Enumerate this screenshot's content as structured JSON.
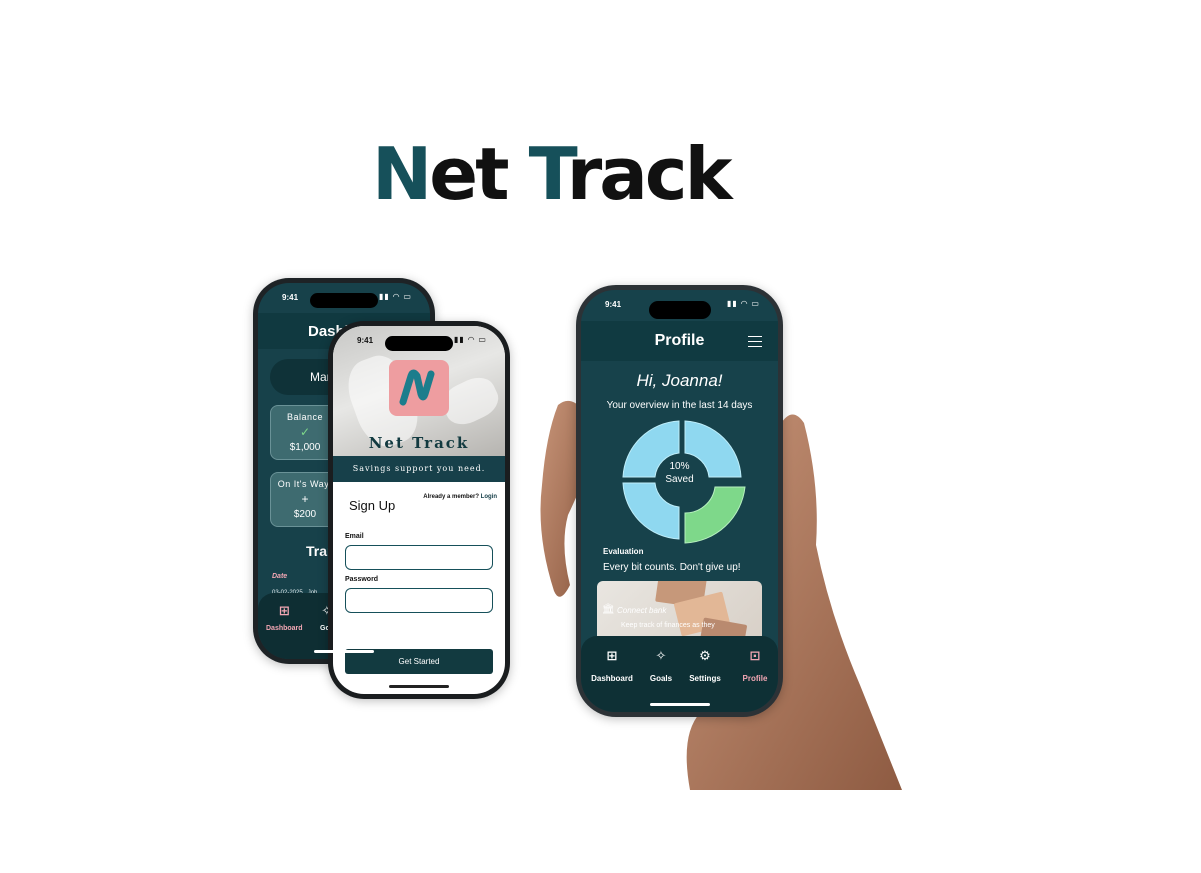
{
  "brand": {
    "part1_first": "N",
    "part1_rest": "et",
    "part2_first": "T",
    "part2_rest": "rack"
  },
  "colors": {
    "primary": "#17424b",
    "accent_pink": "#f3a7b4",
    "donut_blue": "#8fd8f0",
    "donut_green": "#7ed88a"
  },
  "dashboard_phone": {
    "time": "9:41",
    "title": "Dashb",
    "month": "Marc",
    "balance_card": {
      "label": "Balance",
      "icon": "check-circle-icon",
      "value": "$1,000"
    },
    "onway_card": {
      "label": "On It's Way!",
      "icon": "plus-icon",
      "value": "$200"
    },
    "transactions_heading": "Tran",
    "date_header": "Date",
    "row_date": "03-02-2025",
    "row_name": "Joh",
    "nav": [
      {
        "label": "Dashboard",
        "icon": "grid-icon"
      },
      {
        "label": "Goa",
        "icon": "sparkle-icon"
      }
    ]
  },
  "signup_phone": {
    "time": "9:41",
    "brand_name": "Net Track",
    "tagline": "Savings support you need.",
    "heading": "Sign Up",
    "member_prompt": "Already a member?",
    "login_link": "Login",
    "email_label": "Email",
    "password_label": "Password",
    "cta": "Get Started"
  },
  "profile_phone": {
    "time": "9:41",
    "title": "Profile",
    "greeting": "Hi, Joanna!",
    "overview": "Your overview in the last 14 days",
    "saved_percent": "10%",
    "saved_label": "Saved",
    "evaluation_label": "Evaluation",
    "evaluation_text": "Every bit counts. Don't give up!",
    "connect_card": {
      "title": "Connect bank",
      "subtitle": "Keep track of finances as they"
    },
    "nav": [
      {
        "label": "Dashboard",
        "icon": "grid-icon"
      },
      {
        "label": "Goals",
        "icon": "sparkle-icon"
      },
      {
        "label": "Settings",
        "icon": "gear-icon"
      },
      {
        "label": "Profile",
        "icon": "person-icon",
        "active": true
      }
    ]
  }
}
